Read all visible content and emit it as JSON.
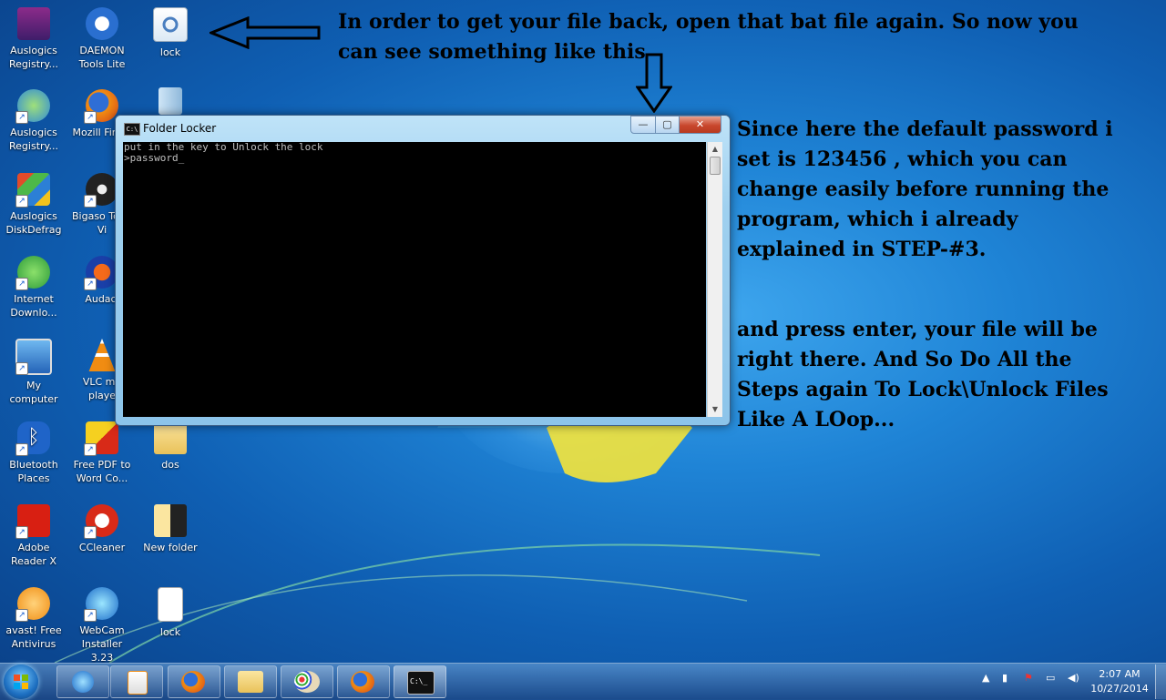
{
  "annotations": {
    "note1": "In order to get your file back, open that bat file again. So now you can see something like this",
    "note2": "Since here the default password i set is 123456 , which you can change easily before running the program, which i already explained in STEP-#3.",
    "note3": "and press enter, your file will be right there. And So Do All the Steps again To Lock\\Unlock Files Like A LOop..."
  },
  "desktop_icons": {
    "winrar": "Auslogics Registry...",
    "daemon": "DAEMON Tools Lite",
    "lock_top": "lock",
    "auslogics2": "Auslogics Registry...",
    "firefox": "Mozill Firefo",
    "recycle": "",
    "diskdefrag": "Auslogics DiskDefrag",
    "bigasoft": "Bigaso Total Vi",
    "idm": "Internet Downlo...",
    "audacity": "Audaci",
    "mycomputer": "My computer",
    "vlc": "VLC me playe",
    "bluetooth": "Bluetooth Places",
    "freepdf": "Free PDF to Word Co...",
    "dos": "dos",
    "adobe": "Adobe Reader X",
    "ccleaner": "CCleaner",
    "newfolder": "New folder",
    "avast": "avast! Free Antivirus",
    "webcam": "WebCam Installer 3.23",
    "lock_bottom": "lock"
  },
  "window": {
    "title": "Folder Locker",
    "line1": "put in the key to Unlock the lock",
    "line2": ">password_",
    "min": "—",
    "max": "▢",
    "close": "✕"
  },
  "taskbar": {
    "time": "2:07 AM",
    "date": "10/27/2014"
  },
  "colors": {
    "desktop": "#1f84d6",
    "console": "#000000",
    "console_text": "#c0c0c0"
  }
}
